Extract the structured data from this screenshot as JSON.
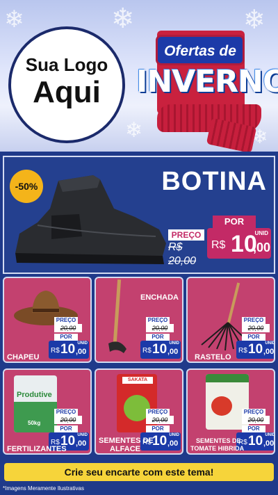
{
  "header": {
    "logo_line1": "Sua Logo",
    "logo_line2": "Aqui",
    "promo_top": "Ofertas de",
    "promo_main": "INVERNO"
  },
  "hero": {
    "discount": "-50%",
    "title": "BOTINA",
    "por_label": "POR",
    "preco_label": "PREÇO",
    "old_price": "R$ 20,00",
    "currency": "R$",
    "price_int": "10",
    "price_cents": ",00",
    "unit": "UNID"
  },
  "products": [
    {
      "name": "CHAPEU",
      "preco_label": "PREÇO",
      "old_price": "20,00",
      "por_label": "POR",
      "currency": "R$",
      "price_int": "10",
      "price_cents": ",00",
      "unit": "UNID"
    },
    {
      "name": "ENCHADA",
      "preco_label": "PREÇO",
      "old_price": "20,00",
      "por_label": "POR",
      "currency": "R$",
      "price_int": "10",
      "price_cents": ",00",
      "unit": "UNID"
    },
    {
      "name": "RASTELO",
      "preco_label": "PREÇO",
      "old_price": "20,00",
      "por_label": "POR",
      "currency": "R$",
      "price_int": "10",
      "price_cents": ",00",
      "unit": "UNID"
    },
    {
      "name": "FERTILIZANTES",
      "preco_label": "PREÇO",
      "old_price": "20,00",
      "por_label": "POR",
      "currency": "R$",
      "price_int": "10",
      "price_cents": ",00",
      "unit": "UNID",
      "pkg_brand": "Produtive",
      "pkg_weight": "50kg"
    },
    {
      "name_line1": "SEMENTES DE",
      "name_line2": "ALFACE",
      "preco_label": "PREÇO",
      "old_price": "20,00",
      "por_label": "POR",
      "currency": "R$",
      "price_int": "10",
      "price_cents": ",00",
      "unit": "UNID",
      "pkg_brand": "SAKATA"
    },
    {
      "name_line1": "SEMENTES DE",
      "name_line2": "TOMATE HIBRIDA",
      "preco_label": "PREÇO",
      "old_price": "20,00",
      "por_label": "POR",
      "currency": "R$",
      "price_int": "10",
      "price_cents": ",00",
      "unit": "UNID"
    }
  ],
  "cta": "Crie seu encarte com este tema!",
  "footnote": "*Imagens Meramente Ilustrativas",
  "colors": {
    "navy": "#1f3a8a",
    "magenta": "#c3416f",
    "price_blue": "#1c3aa8",
    "yellow": "#f6d43a"
  }
}
